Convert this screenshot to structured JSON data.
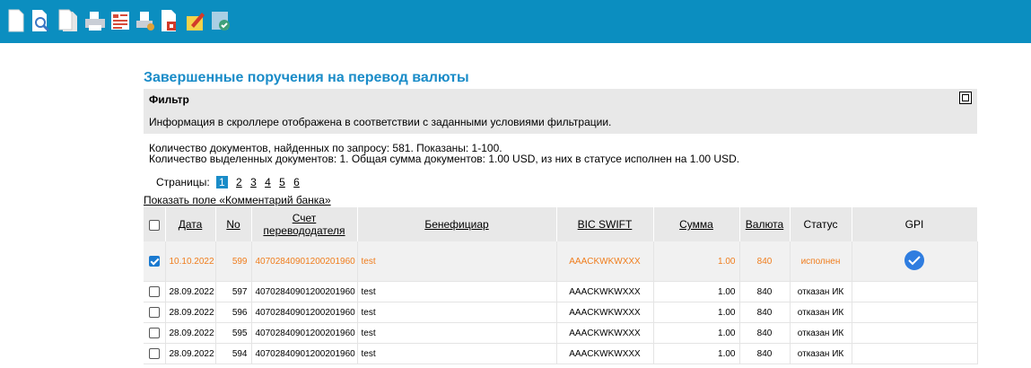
{
  "toolbar": {
    "icons": [
      "new-document-icon",
      "preview-icon",
      "copy-icon",
      "print-icon",
      "report-icon",
      "print-setup-icon",
      "export-icon",
      "edit-icon",
      "gpi-check-icon"
    ]
  },
  "page_title": "Завершенные поручения на перевод валюты",
  "filter": {
    "title": "Фильтр",
    "text": "Информация в скроллере отображена в соответствии с заданными условиями фильтрации."
  },
  "info": {
    "line1": "Количество  документов, найденных по запросу:  581.   Показаны:  1-100.",
    "line2": "Количество выделенных документов: 1. Общая сумма документов: 1.00 USD, из них в статусе исполнен на 1.00 USD."
  },
  "pages": {
    "label": "Страницы:",
    "current": "1",
    "others": [
      "2",
      "3",
      "4",
      "5",
      "6"
    ]
  },
  "show_comment": "Показать поле «Комментарий банка»",
  "table": {
    "headers": {
      "date": "Дата",
      "no": "No",
      "account": "Счет перевододателя",
      "beneficiary": "Бенефициар",
      "bic": "BIC SWIFT",
      "amount": "Сумма",
      "currency": "Валюта",
      "status": "Статус",
      "gpi": "GPI"
    },
    "rows": [
      {
        "checked": true,
        "date": "10.10.2022",
        "no": "599",
        "account": "40702840901200201960",
        "beneficiary": "test",
        "bic": "AAACKWKWXXX",
        "amount": "1.00",
        "currency": "840",
        "status": "исполнен",
        "gpi": true
      },
      {
        "checked": false,
        "date": "28.09.2022",
        "no": "597",
        "account": "40702840901200201960",
        "beneficiary": "test",
        "bic": "AAACKWKWXXX",
        "amount": "1.00",
        "currency": "840",
        "status": "отказан ИК",
        "gpi": false
      },
      {
        "checked": false,
        "date": "28.09.2022",
        "no": "596",
        "account": "40702840901200201960",
        "beneficiary": "test",
        "bic": "AAACKWKWXXX",
        "amount": "1.00",
        "currency": "840",
        "status": "отказан ИК",
        "gpi": false
      },
      {
        "checked": false,
        "date": "28.09.2022",
        "no": "595",
        "account": "40702840901200201960",
        "beneficiary": "test",
        "bic": "AAACKWKWXXX",
        "amount": "1.00",
        "currency": "840",
        "status": "отказан ИК",
        "gpi": false
      },
      {
        "checked": false,
        "date": "28.09.2022",
        "no": "594",
        "account": "40702840901200201960",
        "beneficiary": "test",
        "bic": "AAACKWKWXXX",
        "amount": "1.00",
        "currency": "840",
        "status": "отказан ИК",
        "gpi": false
      }
    ]
  },
  "colors": {
    "toolbar": "#0b8ec0",
    "title": "#1a8cc8",
    "selected_text": "#f07d1d",
    "header_bg": "#e8e8e8"
  }
}
